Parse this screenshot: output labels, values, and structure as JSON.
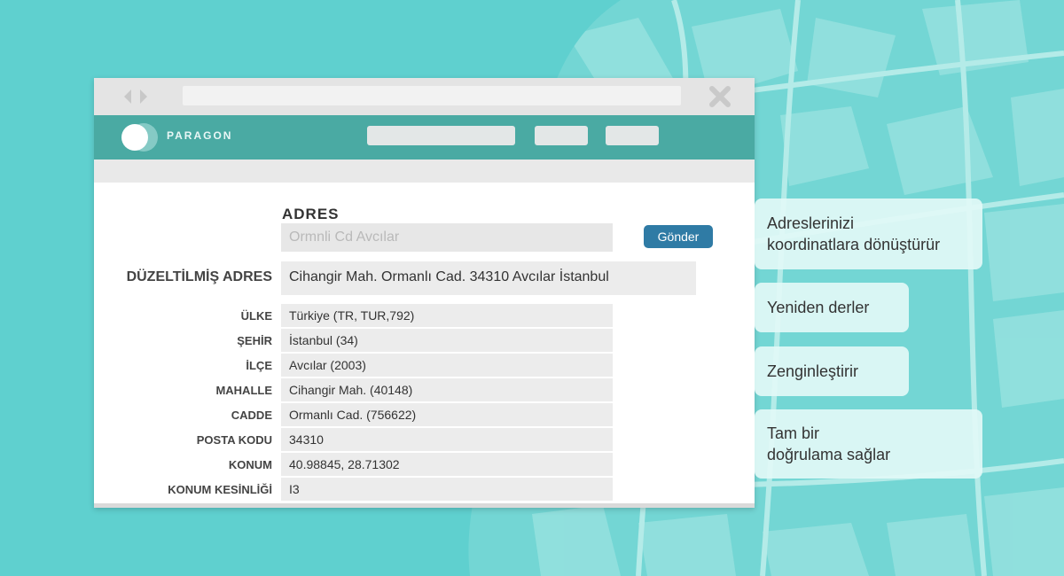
{
  "app": {
    "brand": "PARAGON"
  },
  "form": {
    "address_heading": "ADRES",
    "address_input_placeholder": "Ormnli Cd Avcılar",
    "send_label": "Gönder"
  },
  "corrected": {
    "label": "DÜZELTİLMİŞ ADRES",
    "value": "Cihangir Mah. Ormanlı Cad. 34310 Avcılar İstanbul"
  },
  "details": [
    {
      "label": "ÜLKE",
      "value": "Türkiye (TR, TUR,792)"
    },
    {
      "label": "ŞEHİR",
      "value": "İstanbul (34)"
    },
    {
      "label": "İLÇE",
      "value": "Avcılar (2003)"
    },
    {
      "label": "MAHALLE",
      "value": "Cihangir Mah. (40148)"
    },
    {
      "label": "CADDE",
      "value": "Ormanlı Cad. (756622)"
    },
    {
      "label": "POSTA KODU",
      "value": "34310"
    },
    {
      "label": "KONUM",
      "value": "40.98845, 28.71302"
    },
    {
      "label": "KONUM KESİNLİĞİ",
      "value": "I3"
    }
  ],
  "features": [
    {
      "line1": "Adreslerinizi",
      "line2": "koordinatlara dönüştürür"
    },
    {
      "line1": "Yeniden derler",
      "line2": ""
    },
    {
      "line1": "Zenginleştirir",
      "line2": ""
    },
    {
      "line1": "Tam bir",
      "line2": "doğrulama sağlar"
    }
  ],
  "icons": {
    "back_forward": "chevron-left-right-icon",
    "close": "close-icon",
    "logo": "paragon-logo-icon"
  },
  "colors": {
    "background": "#5fd0cf",
    "app_bar": "#4aaaa3",
    "send_button": "#2f7ba5",
    "card": "#e2f8f6"
  }
}
